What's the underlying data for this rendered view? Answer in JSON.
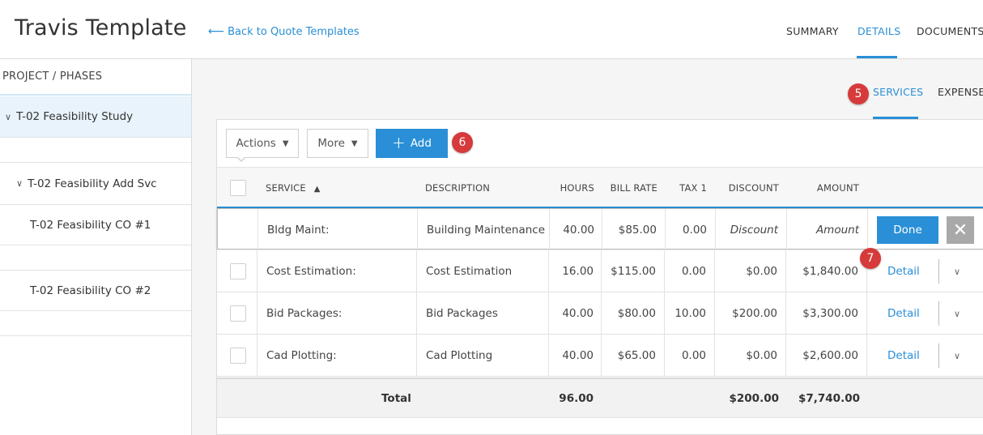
{
  "header": {
    "title": "Travis Template",
    "back_link": "Back to Quote Templates",
    "tabs": [
      {
        "label": "SUMMARY",
        "active": false
      },
      {
        "label": "DETAILS",
        "active": true
      },
      {
        "label": "DOCUMENTS",
        "active": false
      }
    ]
  },
  "sidebar": {
    "header": "PROJECT / PHASES",
    "items": [
      {
        "label": "T-02 Feasibility Study",
        "expanded": true,
        "selected": true
      },
      {
        "label": "T-02 Feasibility Add Svc",
        "expanded": true,
        "selected": false
      },
      {
        "label": "T-02 Feasibility CO #1",
        "selected": false
      },
      {
        "label": "T-02 Feasibility CO #2",
        "selected": false
      }
    ]
  },
  "subtabs": [
    {
      "label": "SERVICES",
      "active": true
    },
    {
      "label": "EXPENSE",
      "active": false
    }
  ],
  "badges": [
    "5",
    "6",
    "7"
  ],
  "toolbar": {
    "actions_label": "Actions",
    "more_label": "More",
    "add_label": "Add"
  },
  "table": {
    "columns": {
      "service": "SERVICE",
      "description": "DESCRIPTION",
      "hours": "HOURS",
      "bill_rate": "BILL RATE",
      "tax1": "TAX 1",
      "discount": "DISCOUNT",
      "amount": "AMOUNT"
    },
    "edit_row": {
      "service": "Bldg Maint:",
      "description": "Building Maintenance",
      "hours": "40.00",
      "bill_rate": "$85.00",
      "tax1": "0.00",
      "discount_placeholder": "Discount",
      "amount_placeholder": "Amount",
      "done_label": "Done"
    },
    "rows": [
      {
        "service": "Cost Estimation:",
        "description": "Cost Estimation",
        "hours": "16.00",
        "bill_rate": "$115.00",
        "tax1": "0.00",
        "discount": "$0.00",
        "amount": "$1,840.00",
        "detail": "Detail"
      },
      {
        "service": "Bid Packages:",
        "description": "Bid Packages",
        "hours": "40.00",
        "bill_rate": "$80.00",
        "tax1": "10.00",
        "discount": "$200.00",
        "amount": "$3,300.00",
        "detail": "Detail"
      },
      {
        "service": "Cad Plotting:",
        "description": "Cad Plotting",
        "hours": "40.00",
        "bill_rate": "$65.00",
        "tax1": "0.00",
        "discount": "$0.00",
        "amount": "$2,600.00",
        "detail": "Detail"
      }
    ],
    "total": {
      "label": "Total",
      "hours": "96.00",
      "discount": "$200.00",
      "amount": "$7,740.00"
    }
  },
  "colors": {
    "accent": "#2a8fd6",
    "badge": "#d63a3a",
    "selected_bg": "#e8f3fb"
  }
}
